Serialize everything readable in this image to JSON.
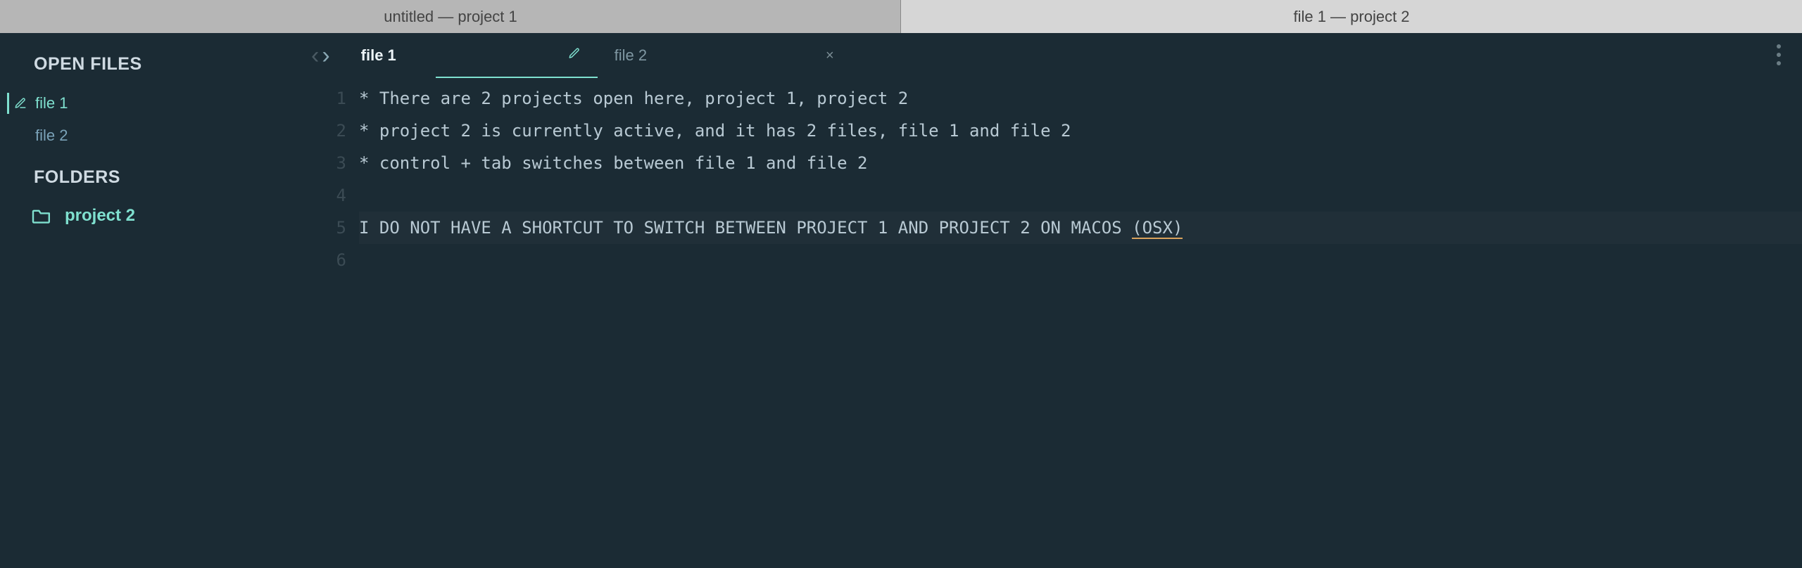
{
  "window_tabs": {
    "inactive_label": "untitled — project 1",
    "active_label": "file 1 — project 2"
  },
  "sidebar": {
    "open_files_heading": "OPEN FILES",
    "folders_heading": "FOLDERS",
    "files": [
      {
        "label": "file 1",
        "active": true,
        "dirty": true
      },
      {
        "label": "file 2",
        "active": false,
        "dirty": false
      }
    ],
    "folders": [
      {
        "label": "project 2"
      }
    ]
  },
  "file_tabs": [
    {
      "label": "file 1",
      "active": true,
      "dirty_icon": "pencil"
    },
    {
      "label": "file 2",
      "active": false,
      "close_icon": "×"
    }
  ],
  "editor": {
    "lines": [
      "* There are 2 projects open here, project 1, project 2",
      "* project 2 is currently active, and it has 2 files, file 1 and file 2",
      "* control + tab switches between file 1 and file 2",
      "",
      "I DO NOT HAVE A SHORTCUT TO SWITCH BETWEEN PROJECT 1 AND PROJECT 2 ON MACOS (OSX)",
      ""
    ],
    "highlight_line_index": 4,
    "underline_token": "(OSX)"
  },
  "icons": {
    "pencil_glyph": "✎",
    "close_glyph": "×"
  }
}
